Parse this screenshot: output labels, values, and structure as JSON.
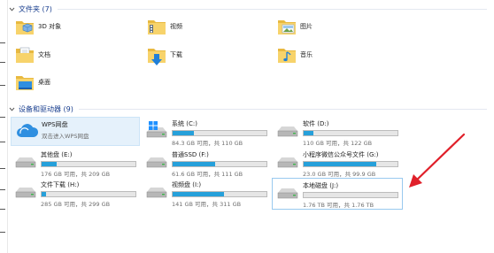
{
  "groups": {
    "folders": {
      "title": "文件夹 (7)"
    },
    "devices": {
      "title": "设备和驱动器 (9)"
    }
  },
  "folders": [
    {
      "name": "3D 对象",
      "icon": "3d-objects-folder-icon"
    },
    {
      "name": "视频",
      "icon": "videos-folder-icon"
    },
    {
      "name": "图片",
      "icon": "pictures-folder-icon"
    },
    {
      "name": "文档",
      "icon": "documents-folder-icon"
    },
    {
      "name": "下载",
      "icon": "downloads-folder-icon"
    },
    {
      "name": "音乐",
      "icon": "music-folder-icon"
    },
    {
      "name": "桌面",
      "icon": "desktop-folder-icon"
    }
  ],
  "drives": [
    {
      "name": "WPS网盘",
      "subtitle": "双击进入WPS网盘",
      "icon": "cloud-icon",
      "selected": true
    },
    {
      "name": "系统 (C:)",
      "free": "84.3 GB 可用，共 110 GB",
      "used_fraction": 0.23,
      "icon": "windows-drive-icon"
    },
    {
      "name": "软件 (D:)",
      "free": "110 GB 可用，共 122 GB",
      "used_fraction": 0.1,
      "icon": "drive-icon"
    },
    {
      "name": "其他盘 (E:)",
      "free": "176 GB 可用，共 209 GB",
      "used_fraction": 0.16,
      "icon": "drive-icon"
    },
    {
      "name": "普通SSD (F:)",
      "free": "61.6 GB 可用，共 111 GB",
      "used_fraction": 0.45,
      "icon": "drive-icon"
    },
    {
      "name": "小程序微信公众号文件 (G:)",
      "free": "23.0 GB 可用，共 99.9 GB",
      "used_fraction": 0.77,
      "icon": "drive-icon"
    },
    {
      "name": "文件下载 (H:)",
      "free": "285 GB 可用，共 299 GB",
      "used_fraction": 0.05,
      "icon": "drive-icon"
    },
    {
      "name": "视频盘 (I:)",
      "free": "141 GB 可用，共 311 GB",
      "used_fraction": 0.55,
      "icon": "drive-icon"
    },
    {
      "name": "本地磁盘 (J:)",
      "free": "1.76 TB 可用，共 1.76 TB",
      "used_fraction": 0.0,
      "icon": "drive-icon",
      "highlighted": true
    }
  ],
  "colors": {
    "accent": "#26a0da",
    "header_text": "#1a3f8f",
    "annotation_arrow": "#e0202a",
    "selection": "#e5f1fb"
  }
}
